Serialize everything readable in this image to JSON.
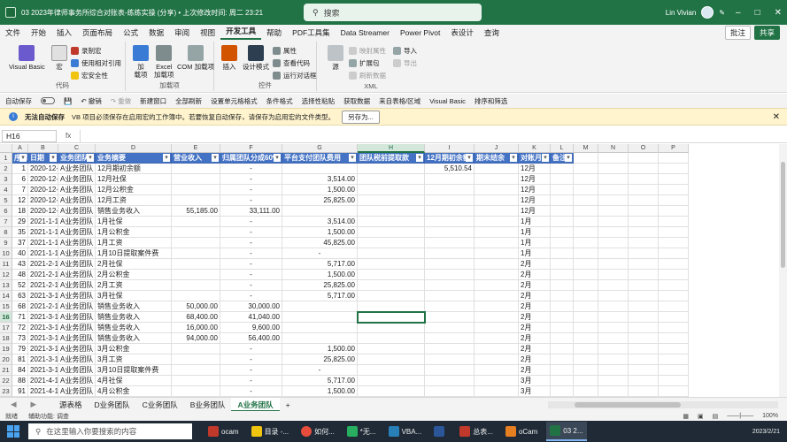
{
  "titlebar": {
    "doc_title": "03 2023年律师事务所综合对账表-练练实操 (分享) • 上次修改时间: 周二 23:21",
    "search_label": "搜索",
    "user_name": "Lin Vivian"
  },
  "menu": {
    "tabs": [
      "文件",
      "开始",
      "插入",
      "页面布局",
      "公式",
      "数据",
      "审阅",
      "视图",
      "开发工具",
      "帮助",
      "PDF工具集",
      "Data Streamer",
      "Power Pivot",
      "表设计",
      "查询"
    ],
    "active_tab": "开发工具",
    "comment_btn": "批注",
    "share_btn": "共享"
  },
  "ribbon": {
    "vb": "Visual Basic",
    "macro": "宏",
    "record": "录制宏",
    "relative": "使用相对引用",
    "security": "宏安全性",
    "group_code": "代码",
    "addins": "加\n载项",
    "excel_addins": "Excel\n加载项",
    "com_addins": "COM 加载项",
    "group_addins": "加载项",
    "insert": "插入",
    "design": "设计模式",
    "props": "属性",
    "viewcode": "查看代码",
    "dialog": "运行对话框",
    "group_controls": "控件",
    "source": "源",
    "map_props": "映射属性",
    "ext_pack": "扩展包",
    "refresh": "刷新数据",
    "import": "导入",
    "export": "导出",
    "group_xml": "XML"
  },
  "quickbar": {
    "autosave": "自动保存",
    "undo": "撤销",
    "redo": "重做",
    "items": [
      "新建窗口",
      "全部刷新",
      "设置单元格格式",
      "条件格式",
      "选择性粘贴",
      "获取数据",
      "来自表格/区域",
      "Visual Basic",
      "排序和筛选"
    ]
  },
  "message": {
    "title": "无法自动保存",
    "text": "VB 项目必须保存在启用宏的工作簿中。若要恢复自动保存，请保存为启用宏的文件类型。",
    "button": "另存为..."
  },
  "formula": {
    "name_box": "H16",
    "fx": "fx",
    "content": ""
  },
  "grid": {
    "columns": [
      "A",
      "B",
      "C",
      "D",
      "E",
      "F",
      "G",
      "H",
      "I",
      "J",
      "K",
      "L",
      "M",
      "N",
      "O",
      "P"
    ],
    "selected_col": "H",
    "selected_row": "16",
    "headers": [
      "序号",
      "日期",
      "业务团队",
      "业务摘要",
      "营业收入",
      "归属团队分成60%",
      "平台支付团队费用",
      "团队税前提取款",
      "12月期初余额",
      "期末结余",
      "对账月份",
      "备注"
    ],
    "rows": [
      {
        "r": "2",
        "cells": [
          "1",
          "2020-12-1",
          "A业务团队",
          "12月期初余额",
          "",
          "-",
          "",
          "",
          "5,510.54",
          "",
          "12月",
          ""
        ]
      },
      {
        "r": "3",
        "cells": [
          "6",
          "2020-12-15",
          "A业务团队",
          "12月社保",
          "",
          "-",
          "3,514.00",
          "",
          "",
          "",
          "12月",
          ""
        ]
      },
      {
        "r": "4",
        "cells": [
          "7",
          "2020-12-15",
          "A业务团队",
          "12月公积金",
          "",
          "-",
          "1,500.00",
          "",
          "",
          "",
          "12月",
          ""
        ]
      },
      {
        "r": "5",
        "cells": [
          "12",
          "2020-12-15",
          "A业务团队",
          "12月工资",
          "",
          "-",
          "25,825.00",
          "",
          "",
          "",
          "12月",
          ""
        ]
      },
      {
        "r": "6",
        "cells": [
          "18",
          "2020-12-15",
          "A业务团队",
          "销售业务收入",
          "55,185.00",
          "33,111.00",
          "",
          "",
          "",
          "",
          "12月",
          ""
        ]
      },
      {
        "r": "7",
        "cells": [
          "29",
          "2021-1-15",
          "A业务团队",
          "1月社保",
          "",
          "-",
          "3,514.00",
          "",
          "",
          "",
          "1月",
          ""
        ]
      },
      {
        "r": "8",
        "cells": [
          "35",
          "2021-1-15",
          "A业务团队",
          "1月公积金",
          "",
          "-",
          "1,500.00",
          "",
          "",
          "",
          "1月",
          ""
        ]
      },
      {
        "r": "9",
        "cells": [
          "37",
          "2021-1-15",
          "A业务团队",
          "1月工资",
          "",
          "-",
          "45,825.00",
          "",
          "",
          "",
          "1月",
          ""
        ]
      },
      {
        "r": "10",
        "cells": [
          "40",
          "2021-1-10",
          "A业务团队",
          "1月10日提取案件费",
          "",
          "-",
          "-",
          "",
          "",
          "",
          "1月",
          ""
        ]
      },
      {
        "r": "11",
        "cells": [
          "43",
          "2021-2-15",
          "A业务团队",
          "2月社保",
          "",
          "-",
          "5,717.00",
          "",
          "",
          "",
          "2月",
          ""
        ]
      },
      {
        "r": "12",
        "cells": [
          "48",
          "2021-2-15",
          "A业务团队",
          "2月公积金",
          "",
          "-",
          "1,500.00",
          "",
          "",
          "",
          "2月",
          ""
        ]
      },
      {
        "r": "13",
        "cells": [
          "52",
          "2021-2-15",
          "A业务团队",
          "2月工资",
          "",
          "-",
          "25,825.00",
          "",
          "",
          "",
          "2月",
          ""
        ]
      },
      {
        "r": "14",
        "cells": [
          "63",
          "2021-3-15",
          "A业务团队",
          "3月社保",
          "",
          "-",
          "5,717.00",
          "",
          "",
          "",
          "2月",
          ""
        ]
      },
      {
        "r": "15",
        "cells": [
          "68",
          "2021-2-10",
          "A业务团队",
          "销售业务收入",
          "50,000.00",
          "30,000.00",
          "",
          "",
          "",
          "",
          "2月",
          ""
        ]
      },
      {
        "r": "16",
        "cells": [
          "71",
          "2021-3-10",
          "A业务团队",
          "销售业务收入",
          "68,400.00",
          "41,040.00",
          "",
          "",
          "",
          "",
          "2月",
          ""
        ]
      },
      {
        "r": "17",
        "cells": [
          "72",
          "2021-3-10",
          "A业务团队",
          "销售业务收入",
          "16,000.00",
          "9,600.00",
          "",
          "",
          "",
          "",
          "2月",
          ""
        ]
      },
      {
        "r": "18",
        "cells": [
          "73",
          "2021-3-10",
          "A业务团队",
          "销售业务收入",
          "94,000.00",
          "56,400.00",
          "",
          "",
          "",
          "",
          "2月",
          ""
        ]
      },
      {
        "r": "19",
        "cells": [
          "79",
          "2021-3-15",
          "A业务团队",
          "3月公积金",
          "",
          "-",
          "1,500.00",
          "",
          "",
          "",
          "2月",
          ""
        ]
      },
      {
        "r": "20",
        "cells": [
          "81",
          "2021-3-15",
          "A业务团队",
          "3月工资",
          "",
          "-",
          "25,825.00",
          "",
          "",
          "",
          "2月",
          ""
        ]
      },
      {
        "r": "21",
        "cells": [
          "84",
          "2021-3-10",
          "A业务团队",
          "3月10日提取案件费",
          "",
          "-",
          "-",
          "",
          "",
          "",
          "2月",
          ""
        ]
      },
      {
        "r": "22",
        "cells": [
          "88",
          "2021-4-15",
          "A业务团队",
          "4月社保",
          "",
          "-",
          "5,717.00",
          "",
          "",
          "",
          "3月",
          ""
        ]
      },
      {
        "r": "23",
        "cells": [
          "91",
          "2021-4-15",
          "A业务团队",
          "4月公积金",
          "",
          "-",
          "1,500.00",
          "",
          "",
          "",
          "3月",
          ""
        ]
      }
    ]
  },
  "sheets": {
    "tabs": [
      "源表格",
      "D业务团队",
      "C业务团队",
      "B业务团队",
      "A业务团队"
    ],
    "active": "A业务团队",
    "add": "+"
  },
  "status": {
    "ready": "就绪",
    "accessibility": "辅助功能: 调查",
    "zoom": "100%"
  },
  "taskbar": {
    "search_placeholder": "在这里输入你要搜索的内容",
    "apps": [
      "ocam",
      "目录 -...",
      "如何...",
      "*无...",
      "VBA...",
      "",
      "总表...",
      "oCam",
      "03 2..."
    ],
    "clock": "2023/2/21"
  }
}
